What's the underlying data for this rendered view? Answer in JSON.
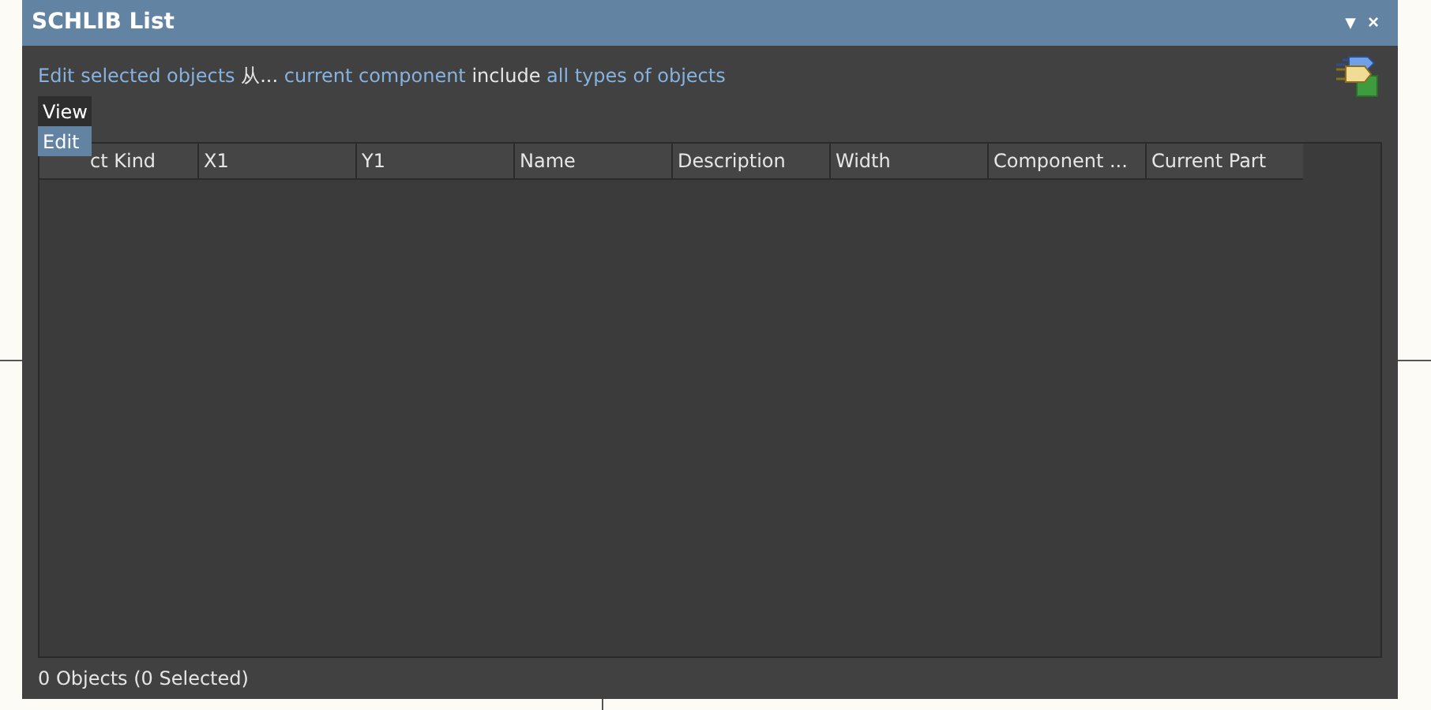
{
  "window": {
    "title": "SCHLIB List",
    "buttons": [
      "▾",
      "×"
    ]
  },
  "filter_line": [
    {
      "kind": "link",
      "text": "Edit"
    },
    {
      "kind": "link",
      "text": "selected objects"
    },
    {
      "kind": "text",
      "text": "从..."
    },
    {
      "kind": "link",
      "text": "current component"
    },
    {
      "kind": "text",
      "text": "include"
    },
    {
      "kind": "link",
      "text": "all types of objects"
    }
  ],
  "menu": [
    {
      "label": "View",
      "selected": false
    },
    {
      "label": "Edit",
      "selected": true
    }
  ],
  "table": {
    "columns": [
      "ct Kind",
      "X1",
      "Y1",
      "Name",
      "Description",
      "Width",
      "Component ...",
      "Current Part"
    ]
  },
  "status_bar": "0 Objects (0 Selected)"
}
